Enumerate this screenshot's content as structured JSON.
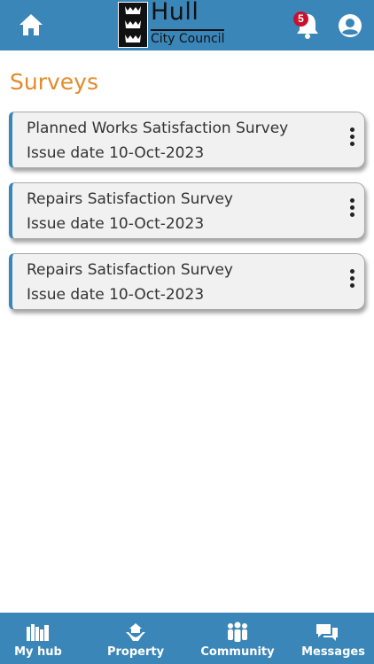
{
  "header": {
    "logo_primary": "Hull",
    "logo_secondary": "City Council",
    "notification_count": "5",
    "icons": [
      "home-icon",
      "bell-icon",
      "user-icon"
    ],
    "background": "#3a86b8"
  },
  "page": {
    "title": "Surveys",
    "title_color": "#e38a2b"
  },
  "surveys": [
    {
      "title": "Planned Works Satisfaction Survey",
      "issue": "Issue date 10-Oct-2023"
    },
    {
      "title": "Repairs Satisfaction Survey",
      "issue": "Issue date 10-Oct-2023"
    },
    {
      "title": "Repairs Satisfaction Survey",
      "issue": "Issue date 10-Oct-2023"
    }
  ],
  "bottom_nav": [
    {
      "label": "My hub",
      "icon": "books-icon"
    },
    {
      "label": "Property",
      "icon": "hand-house-icon"
    },
    {
      "label": "Community",
      "icon": "people-icon"
    },
    {
      "label": "Messages",
      "icon": "chat-icon"
    }
  ]
}
